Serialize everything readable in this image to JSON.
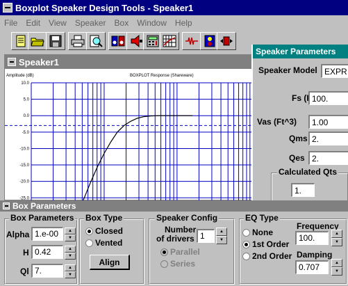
{
  "app": {
    "title": "Boxplot Speaker Design Tools - Speaker1"
  },
  "menu": [
    "File",
    "Edit",
    "View",
    "Speaker",
    "Box",
    "Window",
    "Help"
  ],
  "toolbar": {
    "buttons": [
      "new-document-icon",
      "open-folder-icon",
      "save-disk-icon",
      "print-icon",
      "print-preview-icon",
      "speaker-pair-icon",
      "speaker-volume-icon",
      "calculator-icon",
      "graph-grid-icon",
      "signal-route-icon",
      "speaker-enclosure-icon",
      "speaker-arrows-icon"
    ]
  },
  "speaker_window": {
    "title": "Speaker1"
  },
  "chart_data": {
    "type": "line",
    "title": "BOXPLOT Response (Shareware)",
    "ylabel": "Amplitude (dB)",
    "xlabel": "",
    "ylim": [
      -26,
      10
    ],
    "ytick_labels": [
      "10.0",
      "5.0",
      "0.0",
      "-5.0",
      "-10.0",
      "-15.0",
      "-20.0",
      "-25.0"
    ],
    "x_scale": "log",
    "grid": true,
    "reference_line_db": -3,
    "series": [
      {
        "values": [
          -28,
          -25.0,
          -20.0,
          -15.5,
          -11.5,
          -8.0,
          -5.0,
          -3.0,
          -1.7,
          -0.8,
          -0.3,
          -0.1,
          0,
          0
        ],
        "x_fraction": [
          0.22,
          0.24,
          0.27,
          0.3,
          0.33,
          0.36,
          0.39,
          0.42,
          0.45,
          0.48,
          0.51,
          0.54,
          0.58,
          0.73
        ]
      }
    ]
  },
  "speaker_params": {
    "title": "Speaker Parameters",
    "model_label": "Speaker Model",
    "model_value": "EXPR",
    "fs_label": "Fs (Hz)",
    "fs_value": "100.",
    "vas_label": "Vas (Ft^3)",
    "vas_value": "1.00",
    "qms_label": "Qms",
    "qms_value": "2.",
    "qes_label": "Qes",
    "qes_value": "2.",
    "calc_label": "Calculated Qts",
    "qts_value": "1."
  },
  "box_params": {
    "title": "Box Parameters",
    "group_label": "Box Parameters",
    "alpha_label": "Alpha",
    "alpha_value": "1.e-00",
    "h_label": "H",
    "h_value": "0.42",
    "ql_label": "Ql",
    "ql_value": "7.",
    "box_type_label": "Box Type",
    "closed_label": "Closed",
    "vented_label": "Vented",
    "selected_box_type": "Closed",
    "align_label": "Align",
    "speaker_config_label": "Speaker Config",
    "drivers_label_1": "Number",
    "drivers_label_2": "of drivers",
    "drivers_value": "1",
    "parallel_label": "Parallel",
    "series_label": "Series",
    "eq_type_label": "EQ Type",
    "none_label": "None",
    "first_order_label": "1st Order",
    "second_order_label": "2nd Order",
    "selected_eq": "1st Order",
    "frequency_label": "Frequency",
    "frequency_value": "100.",
    "damping_label": "Damping",
    "damping_value": "0.707"
  }
}
